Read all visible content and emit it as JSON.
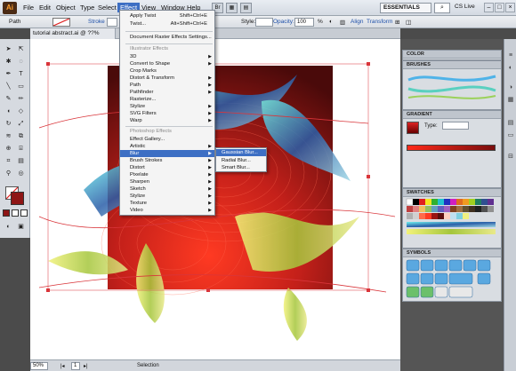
{
  "app": {
    "logo": "Ai"
  },
  "menubar": {
    "items": [
      "File",
      "Edit",
      "Object",
      "Type",
      "Select",
      "Effect",
      "View",
      "Window",
      "Help"
    ],
    "workspace": "ESSENTIALS",
    "search_icon": "search-icon",
    "cs_live": "CS Live",
    "window_buttons": [
      "–",
      "□",
      "×"
    ]
  },
  "control_bar": {
    "selection_type": "Path",
    "stroke_label": "Stroke",
    "style_label": "Style:",
    "opacity_label": "Opacity:",
    "opacity_value": "100",
    "opacity_unit": "%",
    "align_label": "Align",
    "transform_label": "Transform"
  },
  "document": {
    "tab_title": "tutorial abstract.ai @ ??% (RGB/..."
  },
  "effect_menu": {
    "items": [
      {
        "label": "Apply Twist",
        "shortcut": "Shift+Ctrl+E"
      },
      {
        "label": "Twist...",
        "shortcut": "Alt+Shift+Ctrl+E"
      },
      {
        "label": "Document Raster Effects Settings...",
        "shortcut": ""
      }
    ],
    "illustrator_header": "Illustrator Effects",
    "illustrator_items": [
      "3D",
      "Convert to Shape",
      "Crop Marks",
      "Distort & Transform",
      "Path",
      "Pathfinder",
      "Rasterize...",
      "Stylize",
      "SVG Filters",
      "Warp"
    ],
    "photoshop_header": "Photoshop Effects",
    "photoshop_items": [
      "Effect Gallery...",
      "Artistic",
      "Blur",
      "Brush Strokes",
      "Distort",
      "Pixelate",
      "Sharpen",
      "Sketch",
      "Stylize",
      "Texture",
      "Video"
    ],
    "highlighted": "Blur"
  },
  "blur_submenu": {
    "items": [
      "Gaussian Blur...",
      "Radial Blur...",
      "Smart Blur..."
    ],
    "highlighted": "Gaussian Blur..."
  },
  "panels": {
    "color": "COLOR",
    "brushes": "BRUSHES",
    "gradient": "GRADIENT",
    "gradient_type_label": "Type:",
    "swatches": "SWATCHES",
    "symbols": "SYMBOLS"
  },
  "status_bar": {
    "zoom": "50%",
    "page": "1",
    "tool": "Selection"
  },
  "colors": {
    "artboard_dark": "#5b0d0d",
    "artboard_red": "#d42a1a",
    "menu_highlight": "#3d6fc4",
    "selection_red": "#d9353a"
  }
}
